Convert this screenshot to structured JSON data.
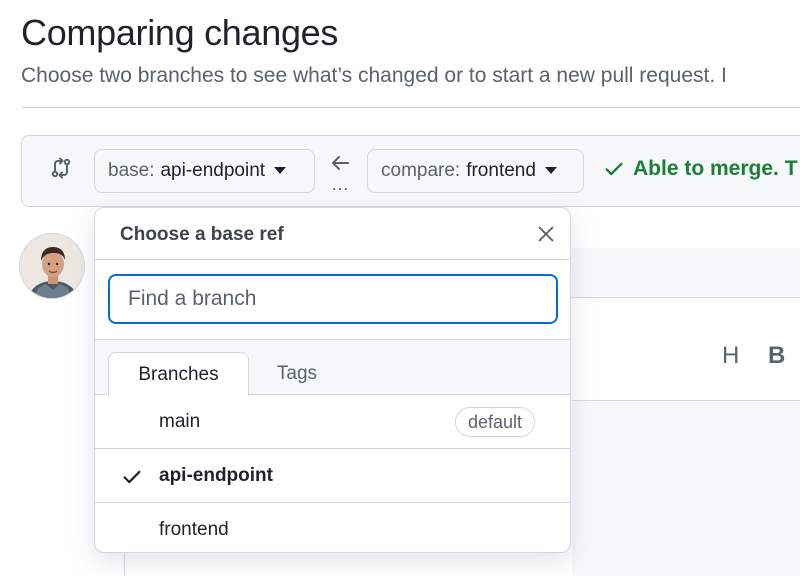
{
  "header": {
    "title": "Comparing changes",
    "subtitle": "Choose two branches to see what’s changed or to start a new pull request. I"
  },
  "range": {
    "base_prefix": "base:",
    "base_value": "api-endpoint",
    "compare_prefix": "compare:",
    "compare_value": "frontend",
    "dots": "…",
    "merge_status": "Able to merge. T"
  },
  "editor_toolbar": {
    "heading_label": "H",
    "bold_label": "B"
  },
  "dropdown": {
    "title": "Choose a base ref",
    "filter_placeholder": "Find a branch",
    "tabs": [
      {
        "label": "Branches",
        "active": true
      },
      {
        "label": "Tags",
        "active": false
      }
    ],
    "items": [
      {
        "name": "main",
        "badge": "default",
        "selected": false
      },
      {
        "name": "api-endpoint",
        "badge": "",
        "selected": true
      },
      {
        "name": "frontend",
        "badge": "",
        "selected": false
      }
    ]
  },
  "colors": {
    "accent_blue": "#0969da",
    "success_green": "#1a7f37",
    "border": "#d1d9e0",
    "muted_text": "#59636e"
  },
  "icons": [
    "git-compare-icon",
    "arrow-left-icon",
    "caret-down-icon",
    "check-icon",
    "close-icon"
  ]
}
